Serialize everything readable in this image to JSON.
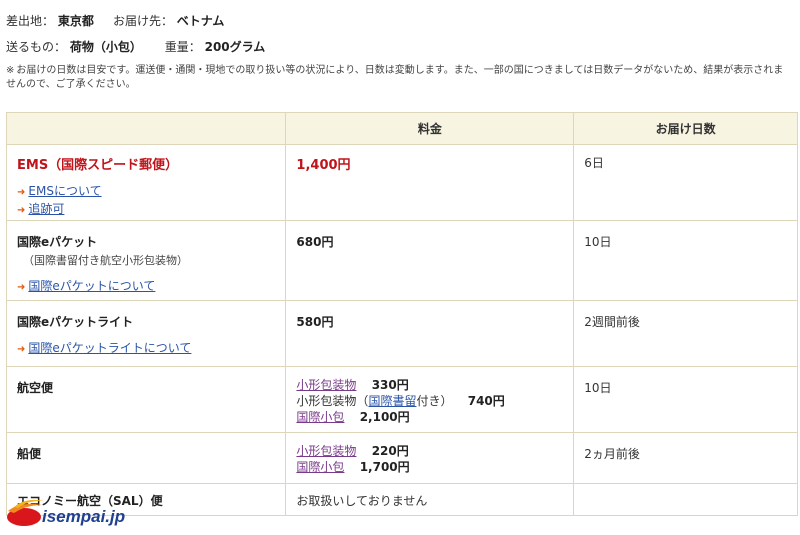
{
  "header": {
    "origin_label": "差出地：",
    "origin_value": "東京都",
    "dest_label": "お届け先：",
    "dest_value": "ベトナム",
    "item_label": "送るもの：",
    "item_value": "荷物（小包）",
    "weight_label": "重量：",
    "weight_value": "200グラム"
  },
  "note": {
    "mark": "※",
    "text": "お届けの日数は目安です。運送便・通関・現地での取り扱い等の状況により、日数は変動します。また、一部の国につきましては日数データがないため、結果が表示されませんので、ご了承ください。"
  },
  "table": {
    "headers": [
      "",
      "料金",
      "お届け日数"
    ],
    "ems": {
      "name": "EMS（国際スピード郵便）",
      "links": [
        "EMSについて",
        "追跡可"
      ],
      "price": "1,400円",
      "days": "6日"
    },
    "epacket": {
      "name": "国際eパケット",
      "sub": "（国際書留付き航空小形包装物）",
      "link": "国際eパケットについて",
      "price": "680円",
      "days": "10日"
    },
    "epacket_light": {
      "name": "国際eパケットライト",
      "link": "国際eパケットライトについて",
      "price": "580円",
      "days": "2週間前後"
    },
    "air": {
      "name": "航空便",
      "line1_link": "小形包装物",
      "line1_price": "330円",
      "line2_pre": "小形包装物（",
      "line2_link": "国際書留",
      "line2_post": "付き）",
      "line2_price": "740円",
      "line3_link": "国際小包",
      "line3_price": "2,100円",
      "days": "10日"
    },
    "ship": {
      "name": "船便",
      "line1_link": "小形包装物",
      "line1_price": "220円",
      "line2_link": "国際小包",
      "line2_price": "1,700円",
      "days": "2ヵ月前後"
    },
    "sal": {
      "name": "エコノミー航空（SAL）便",
      "price": "お取扱いしておりません"
    }
  },
  "logo": {
    "text": "isempai.jp"
  },
  "colors": {
    "accent_red": "#c0141b",
    "link_blue": "#2b54a8",
    "header_bg": "#f7f4e1",
    "arrow_orange": "#e05a10"
  }
}
